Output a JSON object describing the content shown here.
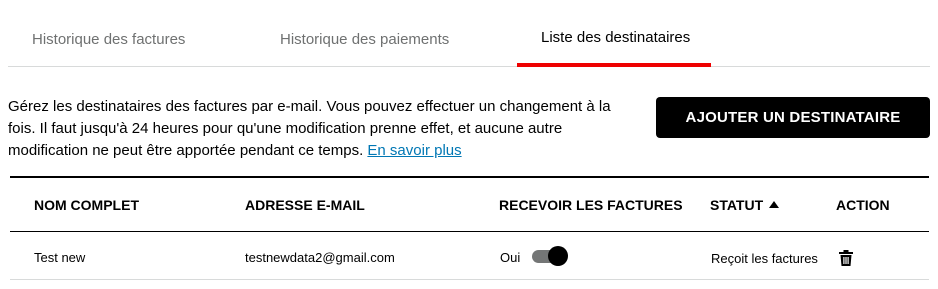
{
  "tabs": [
    {
      "label": "Historique des factures",
      "active": false
    },
    {
      "label": "Historique des paiements",
      "active": false
    },
    {
      "label": "Liste des destinataires",
      "active": true
    }
  ],
  "description": {
    "text": "Gérez les destinataires des factures par e-mail. Vous pouvez effectuer un changement à la fois. Il faut jusqu'à 24 heures pour qu'une modification prenne effet, et aucune autre modification ne peut être apportée pendant ce temps.",
    "link_label": "En savoir plus"
  },
  "add_button_label": "AJOUTER UN DESTINATAIRE",
  "table": {
    "headers": {
      "name": "NOM COMPLET",
      "email": "ADRESSE E-MAIL",
      "invoice": "RECEVOIR LES FACTURES",
      "status": "STATUT",
      "action": "ACTION"
    },
    "sort": {
      "column": "status",
      "direction": "ascending"
    },
    "rows": [
      {
        "name": "Test new",
        "email": "testnewdata2@gmail.com",
        "invoice_label": "Oui",
        "invoice_enabled": true,
        "status": "Reçoit les factures",
        "action_icon": "trash-icon"
      }
    ]
  },
  "colors": {
    "accent": "#ee0000",
    "link": "#0077b4",
    "button_bg": "#000000",
    "button_text": "#ffffff",
    "inactive_tab_text": "#6f7171"
  }
}
